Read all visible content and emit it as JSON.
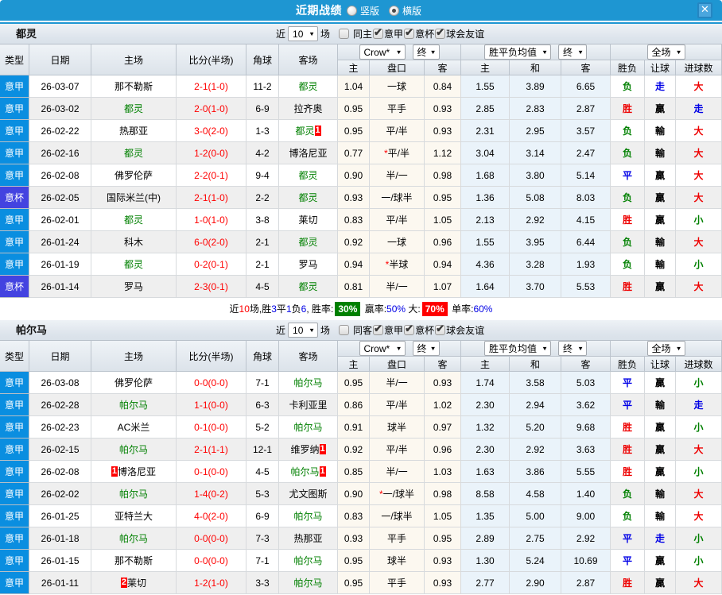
{
  "window": {
    "title": "近期战绩",
    "view_options": [
      {
        "label": "竖版",
        "selected": false
      },
      {
        "label": "横版",
        "selected": true
      }
    ],
    "close_icon": "✕"
  },
  "colors": {
    "titlebar": "#1e96d2",
    "serie_a": "#0a8ee0",
    "cup": "#4343e0",
    "focus_team": "#008000",
    "score": "#ff0000",
    "win": "#ee0000",
    "draw": "#0000e6",
    "lose": "#008000"
  },
  "table_header": {
    "left_cols": [
      "类型",
      "日期",
      "主场",
      "比分(半场)",
      "角球",
      "客场"
    ],
    "asia_selects": [
      "Crow*",
      "终"
    ],
    "asia_cols": [
      "主",
      "盘口",
      "客"
    ],
    "europe_selects": [
      "胜平负均值",
      "终"
    ],
    "europe_cols": [
      "主",
      "和",
      "客"
    ],
    "result_selects": [
      "全场"
    ],
    "result_cols": [
      "胜负",
      "让球",
      "进球数"
    ]
  },
  "sections": [
    {
      "team": "都灵",
      "filter": {
        "near_label": "近",
        "count": "10",
        "games_label": "场",
        "venue_label": "同主",
        "venue_checked": false,
        "leagues": [
          {
            "label": "意甲",
            "checked": true
          },
          {
            "label": "意杯",
            "checked": true
          },
          {
            "label": "球会友谊",
            "checked": true
          }
        ]
      },
      "rows": [
        {
          "league": "意甲",
          "lg": 0,
          "date": "26-03-07",
          "home": {
            "name": "那不勒斯"
          },
          "score": "2-1(1-0)",
          "corners": "11-2",
          "away": {
            "name": "都灵",
            "self": true
          },
          "asia": [
            "1.04",
            "一球",
            "0.84"
          ],
          "star": false,
          "euro": [
            "1.55",
            "3.89",
            "6.65"
          ],
          "res": [
            "负",
            "走",
            "大"
          ]
        },
        {
          "league": "意甲",
          "lg": 0,
          "date": "26-03-02",
          "home": {
            "name": "都灵",
            "self": true
          },
          "score": "2-0(1-0)",
          "corners": "6-9",
          "away": {
            "name": "拉齐奥"
          },
          "asia": [
            "0.95",
            "平手",
            "0.93"
          ],
          "star": false,
          "euro": [
            "2.85",
            "2.83",
            "2.87"
          ],
          "res": [
            "胜",
            "贏",
            "走"
          ]
        },
        {
          "league": "意甲",
          "lg": 0,
          "date": "26-02-22",
          "home": {
            "name": "热那亚"
          },
          "score": "3-0(2-0)",
          "corners": "1-3",
          "away": {
            "name": "都灵",
            "self": true,
            "badge": "1",
            "badge_pos": "after"
          },
          "asia": [
            "0.95",
            "平/半",
            "0.93"
          ],
          "star": false,
          "euro": [
            "2.31",
            "2.95",
            "3.57"
          ],
          "res": [
            "负",
            "輸",
            "大"
          ]
        },
        {
          "league": "意甲",
          "lg": 0,
          "date": "26-02-16",
          "home": {
            "name": "都灵",
            "self": true
          },
          "score": "1-2(0-0)",
          "corners": "4-2",
          "away": {
            "name": "博洛尼亚"
          },
          "asia": [
            "0.77",
            "平/半",
            "1.12"
          ],
          "star": true,
          "euro": [
            "3.04",
            "3.14",
            "2.47"
          ],
          "res": [
            "负",
            "輸",
            "大"
          ]
        },
        {
          "league": "意甲",
          "lg": 0,
          "date": "26-02-08",
          "home": {
            "name": "佛罗伦萨"
          },
          "score": "2-2(0-1)",
          "corners": "9-4",
          "away": {
            "name": "都灵",
            "self": true
          },
          "asia": [
            "0.90",
            "半/一",
            "0.98"
          ],
          "star": false,
          "euro": [
            "1.68",
            "3.80",
            "5.14"
          ],
          "res": [
            "平",
            "贏",
            "大"
          ]
        },
        {
          "league": "意杯",
          "lg": 1,
          "date": "26-02-05",
          "home": {
            "name": "国际米兰(中)"
          },
          "score": "2-1(1-0)",
          "corners": "2-2",
          "away": {
            "name": "都灵",
            "self": true
          },
          "asia": [
            "0.93",
            "一/球半",
            "0.95"
          ],
          "star": false,
          "euro": [
            "1.36",
            "5.08",
            "8.03"
          ],
          "res": [
            "负",
            "贏",
            "大"
          ]
        },
        {
          "league": "意甲",
          "lg": 0,
          "date": "26-02-01",
          "home": {
            "name": "都灵",
            "self": true
          },
          "score": "1-0(1-0)",
          "corners": "3-8",
          "away": {
            "name": "莱切"
          },
          "asia": [
            "0.83",
            "平/半",
            "1.05"
          ],
          "star": false,
          "euro": [
            "2.13",
            "2.92",
            "4.15"
          ],
          "res": [
            "胜",
            "贏",
            "小"
          ]
        },
        {
          "league": "意甲",
          "lg": 0,
          "date": "26-01-24",
          "home": {
            "name": "科木"
          },
          "score": "6-0(2-0)",
          "corners": "2-1",
          "away": {
            "name": "都灵",
            "self": true
          },
          "asia": [
            "0.92",
            "一球",
            "0.96"
          ],
          "star": false,
          "euro": [
            "1.55",
            "3.95",
            "6.44"
          ],
          "res": [
            "负",
            "輸",
            "大"
          ]
        },
        {
          "league": "意甲",
          "lg": 0,
          "date": "26-01-19",
          "home": {
            "name": "都灵",
            "self": true
          },
          "score": "0-2(0-1)",
          "corners": "2-1",
          "away": {
            "name": "罗马"
          },
          "asia": [
            "0.94",
            "半球",
            "0.94"
          ],
          "star": true,
          "euro": [
            "4.36",
            "3.28",
            "1.93"
          ],
          "res": [
            "负",
            "輸",
            "小"
          ]
        },
        {
          "league": "意杯",
          "lg": 1,
          "date": "26-01-14",
          "home": {
            "name": "罗马"
          },
          "score": "2-3(0-1)",
          "corners": "4-5",
          "away": {
            "name": "都灵",
            "self": true
          },
          "asia": [
            "0.81",
            "半/一",
            "1.07"
          ],
          "star": false,
          "euro": [
            "1.64",
            "3.70",
            "5.53"
          ],
          "res": [
            "胜",
            "贏",
            "大"
          ]
        }
      ],
      "summary": [
        {
          "t": "近"
        },
        {
          "t": "10",
          "c": "red"
        },
        {
          "t": "场,胜"
        },
        {
          "t": "3",
          "c": "blue"
        },
        {
          "t": "平"
        },
        {
          "t": "1",
          "c": "blue"
        },
        {
          "t": "负"
        },
        {
          "t": "6",
          "c": "blue"
        },
        {
          "t": ", 胜率:"
        },
        {
          "t": "30%",
          "box": "green"
        },
        {
          "t": " 贏率:"
        },
        {
          "t": "50%",
          "c": "blue"
        },
        {
          "t": " 大:"
        },
        {
          "t": "70%",
          "box": "red"
        },
        {
          "t": " 单率:"
        },
        {
          "t": "60%",
          "c": "blue"
        }
      ]
    },
    {
      "team": "帕尔马",
      "filter": {
        "near_label": "近",
        "count": "10",
        "games_label": "场",
        "venue_label": "同客",
        "venue_checked": false,
        "leagues": [
          {
            "label": "意甲",
            "checked": true
          },
          {
            "label": "意杯",
            "checked": true
          },
          {
            "label": "球会友谊",
            "checked": true
          }
        ]
      },
      "rows": [
        {
          "league": "意甲",
          "lg": 0,
          "date": "26-03-08",
          "home": {
            "name": "佛罗伦萨"
          },
          "score": "0-0(0-0)",
          "corners": "7-1",
          "away": {
            "name": "帕尔马",
            "self": true
          },
          "asia": [
            "0.95",
            "半/一",
            "0.93"
          ],
          "star": false,
          "euro": [
            "1.74",
            "3.58",
            "5.03"
          ],
          "res": [
            "平",
            "贏",
            "小"
          ]
        },
        {
          "league": "意甲",
          "lg": 0,
          "date": "26-02-28",
          "home": {
            "name": "帕尔马",
            "self": true
          },
          "score": "1-1(0-0)",
          "corners": "6-3",
          "away": {
            "name": "卡利亚里"
          },
          "asia": [
            "0.86",
            "平/半",
            "1.02"
          ],
          "star": false,
          "euro": [
            "2.30",
            "2.94",
            "3.62"
          ],
          "res": [
            "平",
            "輸",
            "走"
          ]
        },
        {
          "league": "意甲",
          "lg": 0,
          "date": "26-02-23",
          "home": {
            "name": "AC米兰"
          },
          "score": "0-1(0-0)",
          "corners": "5-2",
          "away": {
            "name": "帕尔马",
            "self": true
          },
          "asia": [
            "0.91",
            "球半",
            "0.97"
          ],
          "star": false,
          "euro": [
            "1.32",
            "5.20",
            "9.68"
          ],
          "res": [
            "胜",
            "贏",
            "小"
          ]
        },
        {
          "league": "意甲",
          "lg": 0,
          "date": "26-02-15",
          "home": {
            "name": "帕尔马",
            "self": true
          },
          "score": "2-1(1-1)",
          "corners": "12-1",
          "away": {
            "name": "维罗纳",
            "badge": "1",
            "badge_pos": "after"
          },
          "asia": [
            "0.92",
            "平/半",
            "0.96"
          ],
          "star": false,
          "euro": [
            "2.30",
            "2.92",
            "3.63"
          ],
          "res": [
            "胜",
            "贏",
            "大"
          ]
        },
        {
          "league": "意甲",
          "lg": 0,
          "date": "26-02-08",
          "home": {
            "name": "博洛尼亚",
            "badge": "1",
            "badge_pos": "before"
          },
          "score": "0-1(0-0)",
          "corners": "4-5",
          "away": {
            "name": "帕尔马",
            "self": true,
            "badge": "1",
            "badge_pos": "after"
          },
          "asia": [
            "0.85",
            "半/一",
            "1.03"
          ],
          "star": false,
          "euro": [
            "1.63",
            "3.86",
            "5.55"
          ],
          "res": [
            "胜",
            "贏",
            "小"
          ]
        },
        {
          "league": "意甲",
          "lg": 0,
          "date": "26-02-02",
          "home": {
            "name": "帕尔马",
            "self": true
          },
          "score": "1-4(0-2)",
          "corners": "5-3",
          "away": {
            "name": "尤文图斯"
          },
          "asia": [
            "0.90",
            "一/球半",
            "0.98"
          ],
          "star": true,
          "euro": [
            "8.58",
            "4.58",
            "1.40"
          ],
          "res": [
            "负",
            "輸",
            "大"
          ]
        },
        {
          "league": "意甲",
          "lg": 0,
          "date": "26-01-25",
          "home": {
            "name": "亚特兰大"
          },
          "score": "4-0(2-0)",
          "corners": "6-9",
          "away": {
            "name": "帕尔马",
            "self": true
          },
          "asia": [
            "0.83",
            "一/球半",
            "1.05"
          ],
          "star": false,
          "euro": [
            "1.35",
            "5.00",
            "9.00"
          ],
          "res": [
            "负",
            "輸",
            "大"
          ]
        },
        {
          "league": "意甲",
          "lg": 0,
          "date": "26-01-18",
          "home": {
            "name": "帕尔马",
            "self": true
          },
          "score": "0-0(0-0)",
          "corners": "7-3",
          "away": {
            "name": "热那亚"
          },
          "asia": [
            "0.93",
            "平手",
            "0.95"
          ],
          "star": false,
          "euro": [
            "2.89",
            "2.75",
            "2.92"
          ],
          "res": [
            "平",
            "走",
            "小"
          ]
        },
        {
          "league": "意甲",
          "lg": 0,
          "date": "26-01-15",
          "home": {
            "name": "那不勒斯"
          },
          "score": "0-0(0-0)",
          "corners": "7-1",
          "away": {
            "name": "帕尔马",
            "self": true
          },
          "asia": [
            "0.95",
            "球半",
            "0.93"
          ],
          "star": false,
          "euro": [
            "1.30",
            "5.24",
            "10.69"
          ],
          "res": [
            "平",
            "贏",
            "小"
          ]
        },
        {
          "league": "意甲",
          "lg": 0,
          "date": "26-01-11",
          "home": {
            "name": "莱切",
            "badge": "2",
            "badge_pos": "before"
          },
          "score": "1-2(1-0)",
          "corners": "3-3",
          "away": {
            "name": "帕尔马",
            "self": true
          },
          "asia": [
            "0.95",
            "平手",
            "0.93"
          ],
          "star": false,
          "euro": [
            "2.77",
            "2.90",
            "2.87"
          ],
          "res": [
            "胜",
            "贏",
            "大"
          ]
        }
      ],
      "summary": null
    }
  ]
}
